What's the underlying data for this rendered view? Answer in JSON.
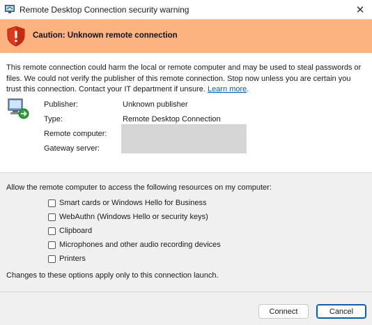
{
  "window": {
    "title": "Remote Desktop Connection security warning",
    "close_glyph": "✕"
  },
  "banner": {
    "title": "Caution: Unknown remote connection",
    "icon": "warning-shield-icon",
    "color": "#fcb37f"
  },
  "description": {
    "text": "This remote connection could harm the local or remote computer and may be used to steal passwords or files. We could not verify the publisher of this remote connection. Stop now unless you are certain you trust this connection. Contact your IT department if unsure. ",
    "link": "Learn more",
    "trail": "."
  },
  "details": {
    "publisher_label": "Publisher:",
    "publisher_value": "Unknown publisher",
    "type_label": "Type:",
    "type_value": "Remote Desktop Connection",
    "remote_computer_label": "Remote computer:",
    "gateway_server_label": "Gateway server:"
  },
  "resources": {
    "heading": "Allow the remote computer to access the following resources on my computer:",
    "items": [
      {
        "label": "Smart cards or Windows Hello for Business",
        "checked": false
      },
      {
        "label": "WebAuthn (Windows Hello or security keys)",
        "checked": false
      },
      {
        "label": "Clipboard",
        "checked": false
      },
      {
        "label": "Microphones and other audio recording devices",
        "checked": false
      },
      {
        "label": "Printers",
        "checked": false
      }
    ],
    "note": "Changes to these options apply only to this connection launch."
  },
  "buttons": {
    "connect": "Connect",
    "cancel": "Cancel"
  },
  "colors": {
    "accent": "#005fb8",
    "link": "#0a58c7"
  }
}
